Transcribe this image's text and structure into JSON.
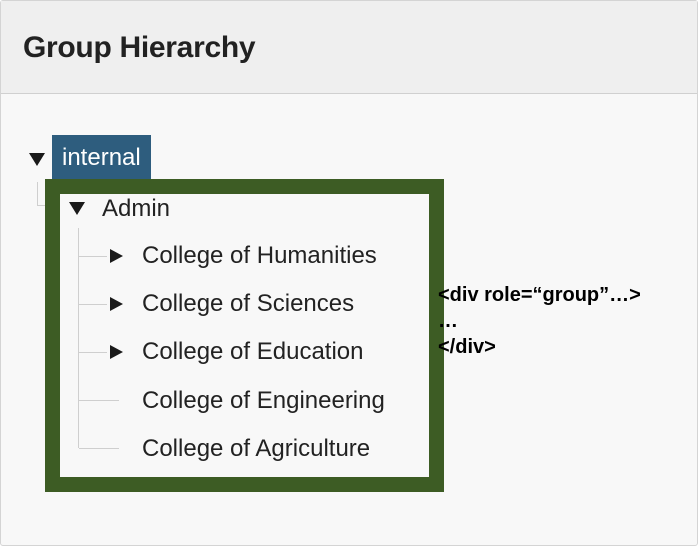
{
  "header": {
    "title": "Group Hierarchy"
  },
  "tree": {
    "root": {
      "label": "internal",
      "expanded": true,
      "selected": true
    },
    "group": {
      "label": "Admin",
      "expanded": true,
      "children": [
        {
          "label": "College of Humanities",
          "expandable": true
        },
        {
          "label": "College of Sciences",
          "expandable": true
        },
        {
          "label": "College of Education",
          "expandable": true
        },
        {
          "label": "College of Engineering",
          "expandable": false
        },
        {
          "label": "College of Agriculture",
          "expandable": false
        }
      ]
    }
  },
  "annotation": {
    "line1": "<div role=“group”…>",
    "line2": "…",
    "line3": "</div>",
    "highlight_color": "#3d5c24"
  },
  "colors": {
    "selected_bg": "#2e5d7e",
    "selected_text": "#ffffff"
  }
}
